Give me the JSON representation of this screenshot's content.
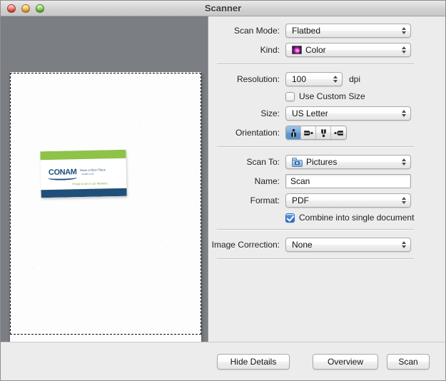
{
  "window": {
    "title": "Scanner",
    "traffic_lights": [
      {
        "name": "close-button",
        "color": "#ee6256"
      },
      {
        "name": "minimize-button",
        "color": "#f7b33f"
      },
      {
        "name": "zoom-button",
        "color": "#7dc94b"
      }
    ]
  },
  "preview": {
    "background_color": "#7b7f84",
    "page_color": "#fdfdfd",
    "selection_label": "scan-selection-marquee",
    "card": {
      "logo_text": "CONAM",
      "tagline": "Have a Nice Place",
      "subtagline": "conam.com",
      "slogan": "Proud to be in our Markets",
      "band_top_color": "#8fc248",
      "band_bottom_color": "#204f79",
      "logo_color": "#1d4f7c"
    }
  },
  "settings": {
    "scan_mode": {
      "label": "Scan Mode:",
      "value": "Flatbed"
    },
    "kind": {
      "label": "Kind:",
      "value": "Color",
      "icon": "color-photo-thumbnail-icon"
    },
    "resolution": {
      "label": "Resolution:",
      "value": "100",
      "unit": "dpi"
    },
    "use_custom_size": {
      "label": "Use Custom Size",
      "checked": false
    },
    "size": {
      "label": "Size:",
      "value": "US Letter"
    },
    "orientation": {
      "label": "Orientation:",
      "selected_index": 0,
      "options": [
        "orientation-portrait-up",
        "orientation-landscape-right",
        "orientation-portrait-down",
        "orientation-landscape-left"
      ]
    },
    "scan_to": {
      "label": "Scan To:",
      "value": "Pictures",
      "icon": "pictures-folder-icon"
    },
    "name": {
      "label": "Name:",
      "value": "Scan",
      "placeholder": "Scan"
    },
    "format": {
      "label": "Format:",
      "value": "PDF"
    },
    "combine_into_single_document": {
      "label": "Combine into single document",
      "checked": true
    },
    "image_correction": {
      "label": "Image Correction:",
      "value": "None"
    }
  },
  "buttons": {
    "hide_details": "Hide Details",
    "overview": "Overview",
    "scan": "Scan"
  },
  "colors": {
    "window_background": "#ececec",
    "preview_background": "#7b7f84",
    "accent_blue": "#3a7fd4",
    "separator": "#c2c2c2"
  }
}
